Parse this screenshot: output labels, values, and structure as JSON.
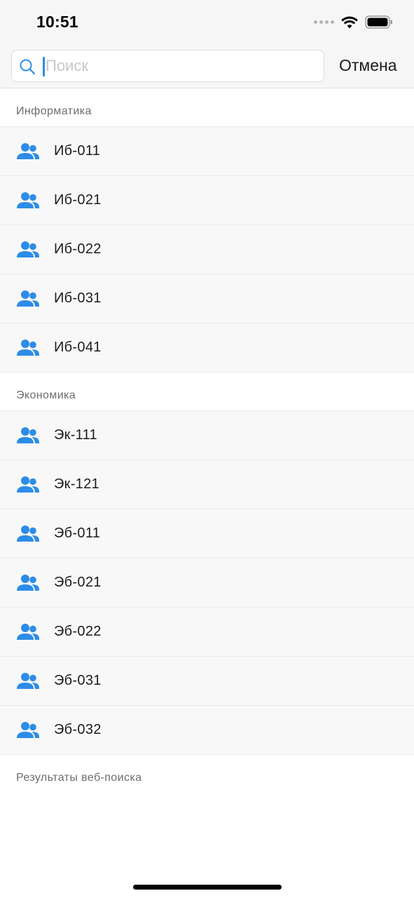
{
  "status_bar": {
    "time": "10:51"
  },
  "search": {
    "placeholder": "Поиск",
    "value": "",
    "cancel_label": "Отмена"
  },
  "colors": {
    "accent": "#2d8ce8",
    "row_background": "#f8f8f8",
    "header_text": "#6d6d72"
  },
  "sections": [
    {
      "title": "Информатика",
      "items": [
        {
          "icon": "group-icon",
          "label": "Иб-011"
        },
        {
          "icon": "group-icon",
          "label": "Иб-021"
        },
        {
          "icon": "group-icon",
          "label": "Иб-022"
        },
        {
          "icon": "group-icon",
          "label": "Иб-031"
        },
        {
          "icon": "group-icon",
          "label": "Иб-041"
        }
      ]
    },
    {
      "title": "Экономика",
      "items": [
        {
          "icon": "group-icon",
          "label": "Эк-111"
        },
        {
          "icon": "group-icon",
          "label": "Эк-121"
        },
        {
          "icon": "group-icon",
          "label": "Эб-011"
        },
        {
          "icon": "group-icon",
          "label": "Эб-021"
        },
        {
          "icon": "group-icon",
          "label": "Эб-022"
        },
        {
          "icon": "group-icon",
          "label": "Эб-031"
        },
        {
          "icon": "group-icon",
          "label": "Эб-032"
        }
      ]
    }
  ],
  "web_results": {
    "title": "Результаты веб-поиска"
  }
}
